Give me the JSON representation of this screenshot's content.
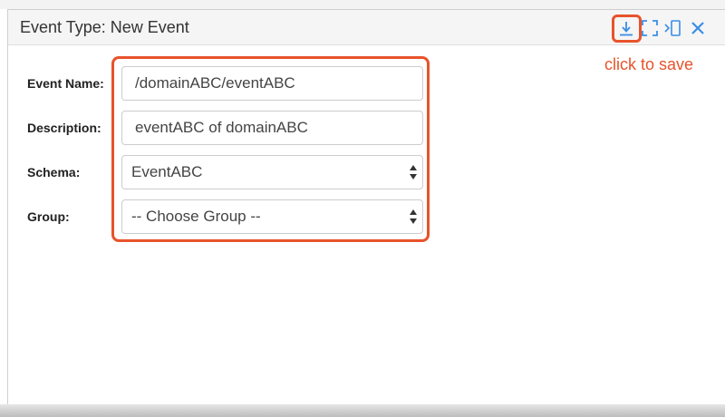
{
  "panel": {
    "title": "Event Type: New Event",
    "header_icons": {
      "save": "download-icon",
      "expand": "expand-icon",
      "dock": "dock-right-icon",
      "close": "close-icon"
    }
  },
  "annotation": {
    "save_hint": "click to save",
    "highlight_color": "#e8532b"
  },
  "form": {
    "event_name": {
      "label": "Event Name:",
      "value": "/domainABC/eventABC"
    },
    "description": {
      "label": "Description:",
      "value": "eventABC of domainABC"
    },
    "schema": {
      "label": "Schema:",
      "value": "EventABC"
    },
    "group": {
      "label": "Group:",
      "value": "-- Choose Group --"
    }
  },
  "colors": {
    "icon_blue": "#3a8ee6",
    "annotation_orange": "#e8532b"
  }
}
